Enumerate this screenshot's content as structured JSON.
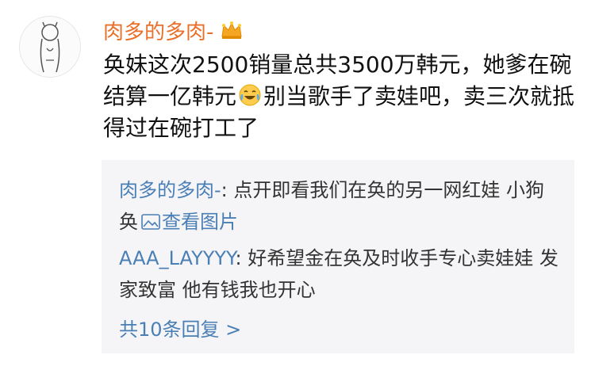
{
  "comment": {
    "username": "肉多的多肉-",
    "badge_icon": "crown-icon",
    "text_part1": "奂妹这次2500销量总共3500万韩元，她爹在碗结算一亿韩元",
    "emoji": "laughing-crying-emoji",
    "text_part2": "别当歌手了卖娃吧，卖三次就抵得过在碗打工了"
  },
  "replies": [
    {
      "name": "肉多的多肉-",
      "separator": ": ",
      "text": "点开即看我们在奂的另一网红娃 小狗奂",
      "link_icon": "image-icon",
      "link_text": "查看图片"
    },
    {
      "name": "AAA_LAYYYY",
      "separator": ": ",
      "text": "好希望金在奂及时收手专心卖娃娃 发家致富 他有钱我也开心"
    }
  ],
  "more_replies": "共10条回复 >",
  "colors": {
    "username": "#e8702a",
    "reply_name": "#4a7fb5",
    "reply_bg": "#f5f5f7"
  }
}
